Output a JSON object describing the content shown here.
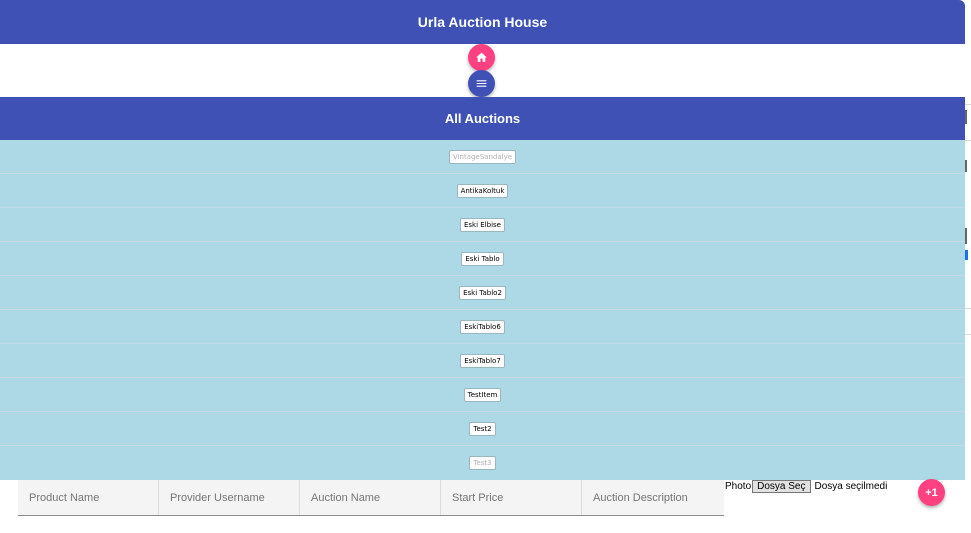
{
  "header": {
    "title": "Urla Auction House"
  },
  "nav": {
    "home_icon": "home-icon",
    "menu_icon": "menu-icon"
  },
  "section": {
    "title": "All Auctions"
  },
  "auctions": [
    {
      "label": "VintageSandalye",
      "faded": true
    },
    {
      "label": "AntikaKoltuk",
      "faded": false
    },
    {
      "label": "Eski Elbise",
      "faded": false
    },
    {
      "label": "Eski Tablo",
      "faded": false
    },
    {
      "label": "Eski Tablo2",
      "faded": false
    },
    {
      "label": "EskiTablo6",
      "faded": false
    },
    {
      "label": "EskiTablo7",
      "faded": false
    },
    {
      "label": "TestItem",
      "faded": false
    },
    {
      "label": "Test2",
      "faded": false
    },
    {
      "label": "Test3",
      "faded": true
    }
  ],
  "table": {
    "columns": [
      "Product Name",
      "Provider Username",
      "Auction Name",
      "Start Price",
      "Auction Description"
    ]
  },
  "upload": {
    "label": "Photo",
    "button": "Dosya Seç",
    "status": "Dosya seçilmedi"
  },
  "add_button": {
    "label": "+1"
  },
  "colors": {
    "primary": "#3f51b5",
    "accent": "#ff4081",
    "list_bg": "#add8e6"
  }
}
